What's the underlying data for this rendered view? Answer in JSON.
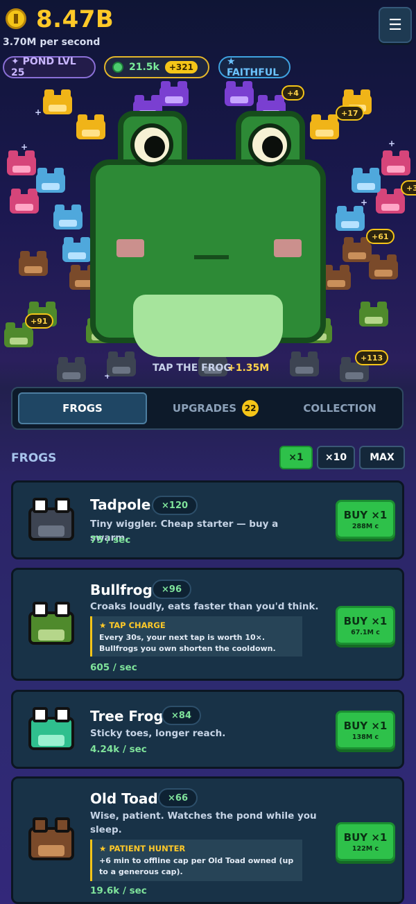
{
  "header": {
    "balance": "8.47B",
    "rate": "3.70M per second",
    "menu_icon": "☰"
  },
  "chips": {
    "pond_level": "✦ POND LVL 25",
    "gems": "21.5k",
    "gems_bonus": "+321",
    "faith": "★ FAITHFUL"
  },
  "stage": {
    "tap_prompt": "TAP THE FROG",
    "tap_gain": "+1.35M",
    "popups": [
      "+4",
      "+17",
      "+3",
      "+61",
      "+91",
      "+113"
    ]
  },
  "tabs": {
    "frogs": "FROGS",
    "upgrades": "UPGRADES",
    "upgrades_badge": "22",
    "collection": "COLLECTION"
  },
  "list": {
    "title": "FROGS",
    "qty_x1": "×1",
    "qty_x10": "×10",
    "qty_max": "MAX"
  },
  "frogs": [
    {
      "name": "Tadpole",
      "count": "×120",
      "desc": "Tiny wiggler. Cheap starter — buy a swarm.",
      "rate": "75 / sec",
      "buy": "BUY ×1",
      "cost": "288M c",
      "color": "#3d4452",
      "belly": "#6b7484"
    },
    {
      "name": "Bullfrog",
      "count": "×96",
      "desc": "Croaks loudly, eats faster than you'd think.",
      "ability_title": "★ TAP CHARGE",
      "ability_text": "Every 30s, your next tap is worth 10×. Bullfrogs you own shorten the cooldown.",
      "rate": "605 / sec",
      "buy": "BUY ×1",
      "cost": "67.1M c",
      "color": "#4f8a2c",
      "belly": "#b5d68a"
    },
    {
      "name": "Tree Frog",
      "count": "×84",
      "desc": "Sticky toes, longer reach.",
      "rate": "4.24k / sec",
      "buy": "BUY ×1",
      "cost": "138M c",
      "color": "#2fbf8e",
      "belly": "#9af0cf"
    },
    {
      "name": "Old Toad",
      "count": "×66",
      "desc": "Wise, patient. Watches the pond while you sleep.",
      "ability_title": "★ PATIENT HUNTER",
      "ability_text": "+6 min to offline cap per Old Toad owned (up to a generous cap).",
      "rate": "19.6k / sec",
      "buy": "BUY ×1",
      "cost": "122M c",
      "color": "#7a4a2a",
      "belly": "#c98f5a"
    }
  ]
}
